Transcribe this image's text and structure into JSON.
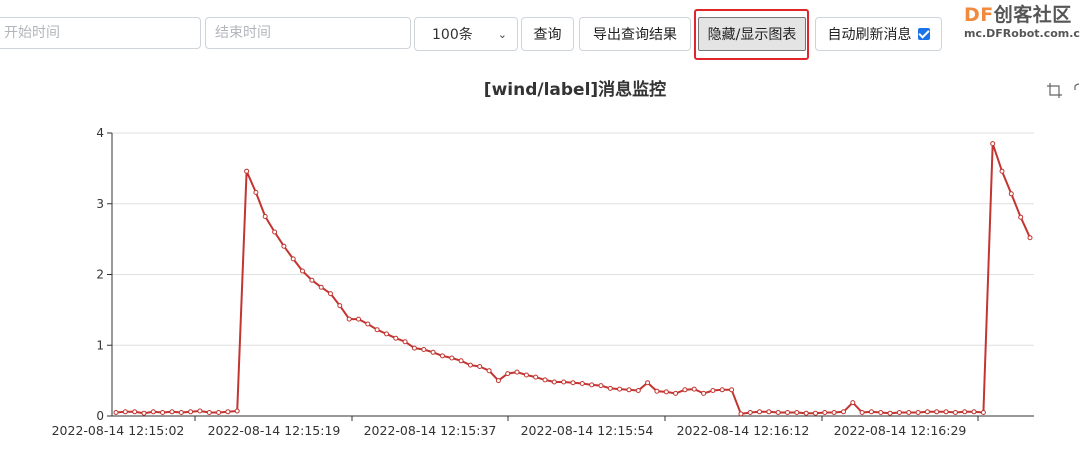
{
  "toolbar": {
    "start_placeholder": "开始时间",
    "end_placeholder": "结束时间",
    "limit_selected": "100条",
    "query_label": "查询",
    "export_label": "导出查询结果",
    "toggle_chart_label": "隐藏/显示图表",
    "auto_refresh_label": "自动刷新消息",
    "auto_refresh_checked": true
  },
  "logo": {
    "brand": "DF",
    "brand_rest": "创客社区",
    "site": "mc.DFRobot.com.cn"
  },
  "colors": {
    "series": "#c23531",
    "axis": "#333333",
    "grid": "#e0e0e0",
    "highlight": "#e0252b"
  },
  "icons": [
    "data-zoom-icon",
    "restore-icon"
  ],
  "chart_data": {
    "type": "line",
    "title": "[wind/label]消息监控",
    "xlabel": "",
    "ylabel": "",
    "ylim": [
      0,
      4
    ],
    "y_ticks": [
      "0",
      "1",
      "2",
      "3",
      "4"
    ],
    "x_tick_labels": [
      "2022-08-14 12:15:02",
      "2022-08-14 12:15:19",
      "2022-08-14 12:15:37",
      "2022-08-14 12:15:54",
      "2022-08-14 12:16:12",
      "2022-08-14 12:16:29"
    ],
    "grid": true,
    "series": [
      {
        "values": [
          0.05,
          0.06,
          0.06,
          0.04,
          0.06,
          0.05,
          0.06,
          0.05,
          0.06,
          0.07,
          0.05,
          0.05,
          0.06,
          0.07,
          3.46,
          3.16,
          2.82,
          2.6,
          2.4,
          2.22,
          2.05,
          1.92,
          1.82,
          1.73,
          1.56,
          1.37,
          1.37,
          1.3,
          1.22,
          1.16,
          1.1,
          1.05,
          0.96,
          0.94,
          0.9,
          0.85,
          0.82,
          0.78,
          0.72,
          0.7,
          0.64,
          0.5,
          0.6,
          0.62,
          0.58,
          0.55,
          0.51,
          0.48,
          0.48,
          0.47,
          0.46,
          0.44,
          0.43,
          0.39,
          0.38,
          0.37,
          0.36,
          0.47,
          0.35,
          0.34,
          0.32,
          0.37,
          0.38,
          0.32,
          0.36,
          0.37,
          0.37,
          0.03,
          0.05,
          0.06,
          0.06,
          0.05,
          0.05,
          0.05,
          0.04,
          0.04,
          0.05,
          0.05,
          0.06,
          0.19,
          0.05,
          0.06,
          0.05,
          0.04,
          0.05,
          0.05,
          0.05,
          0.06,
          0.06,
          0.06,
          0.05,
          0.06,
          0.06,
          0.05,
          3.85,
          3.46,
          3.14,
          2.81,
          2.52
        ]
      }
    ]
  }
}
